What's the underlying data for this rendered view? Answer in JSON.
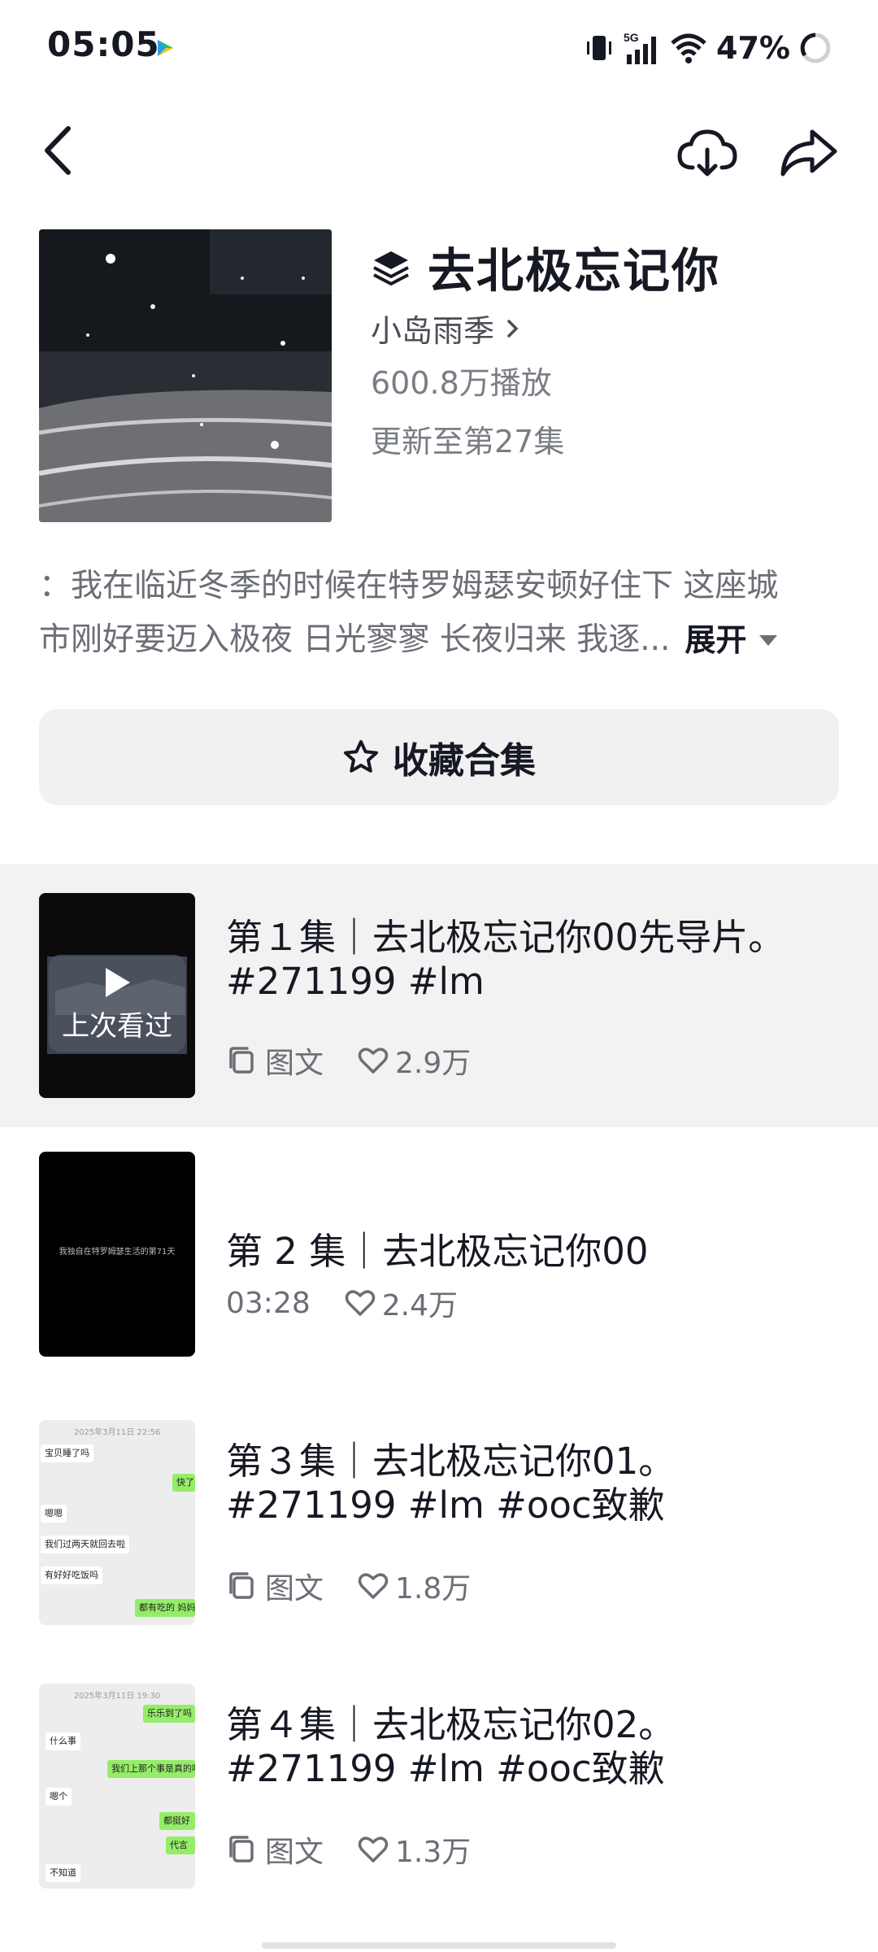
{
  "status_bar": {
    "time": "05:05",
    "battery_pct": "47%",
    "network": "5G",
    "icons": [
      "video-app-icon",
      "vibrate-icon",
      "signal-icon",
      "wifi-icon",
      "battery-ring-icon"
    ]
  },
  "nav": {
    "icons": [
      "back-arrow-icon",
      "download-cloud-icon",
      "share-arrow-icon"
    ]
  },
  "collection": {
    "title": "去北极忘记你",
    "author": "小岛雨季",
    "plays": "600.8万播放",
    "update_status": "更新至第27集",
    "description_line1": "：我在临近冬季的时候在特罗姆瑟安顿好住下 这座城",
    "description_line2": "市刚好要迈入极夜 日光寥寥 长夜归来 我逐...",
    "expand_label": "展开",
    "favorite_label": "收藏合集"
  },
  "episodes": [
    {
      "title": "第１集｜去北极忘记你00先导片。#271199 #lm",
      "type_label": "图文",
      "likes": "2.9万",
      "badge": "上次看过",
      "is_current": true
    },
    {
      "title": "第 2 集｜去北极忘记你00",
      "duration": "03:28",
      "likes": "2.4万",
      "thumb_caption": "我独自在特罗姆瑟生活的第71天"
    },
    {
      "title": "第３集｜去北极忘记你01。#271199 #lm #ooc致歉",
      "type_label": "图文",
      "likes": "1.8万",
      "thumb_chat": {
        "date": "2025年3月11日 22:56",
        "lines": [
          "宝贝睡了吗",
          "快了",
          "嗯嗯",
          "我们过两天就回去啦",
          "有好好吃饭吗",
          "都有吃的 妈妈"
        ]
      }
    },
    {
      "title": "第４集｜去北极忘记你02。#271199 #lm #ooc致歉",
      "type_label": "图文",
      "likes": "1.3万",
      "thumb_chat": {
        "date": "2025年3月11日 19:30",
        "lines": [
          "乐乐到了吗",
          "什么事",
          "我们上那个事是真的吗",
          "嗯个",
          "都挺好",
          "代言",
          "不知道"
        ]
      }
    }
  ],
  "colors": {
    "text_primary": "#161823",
    "text_secondary": "#6b6e76",
    "active_row_bg": "#f2f2f2",
    "button_bg": "#f1f1f2",
    "chat_green": "#95ec69"
  }
}
